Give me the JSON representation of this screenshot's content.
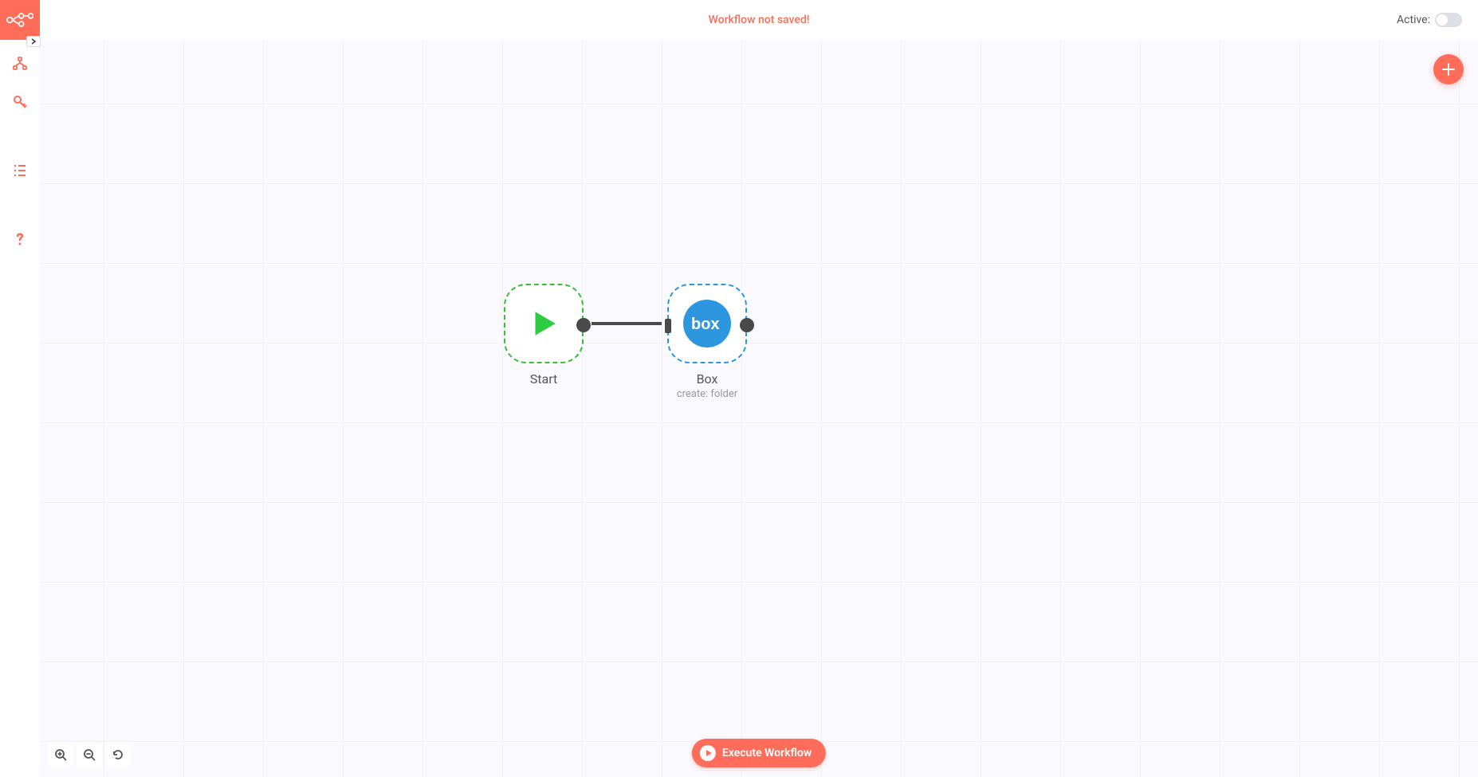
{
  "header": {
    "status": "Workflow not saved!",
    "active_label": "Active:"
  },
  "sidebar": {
    "icons": [
      "workflows",
      "credentials",
      "executions",
      "help"
    ]
  },
  "canvas": {
    "nodes": {
      "start": {
        "title": "Start"
      },
      "box": {
        "title": "Box",
        "subtitle": "create: folder",
        "badge": "box"
      }
    }
  },
  "controls": {
    "execute_label": "Execute Workflow"
  }
}
